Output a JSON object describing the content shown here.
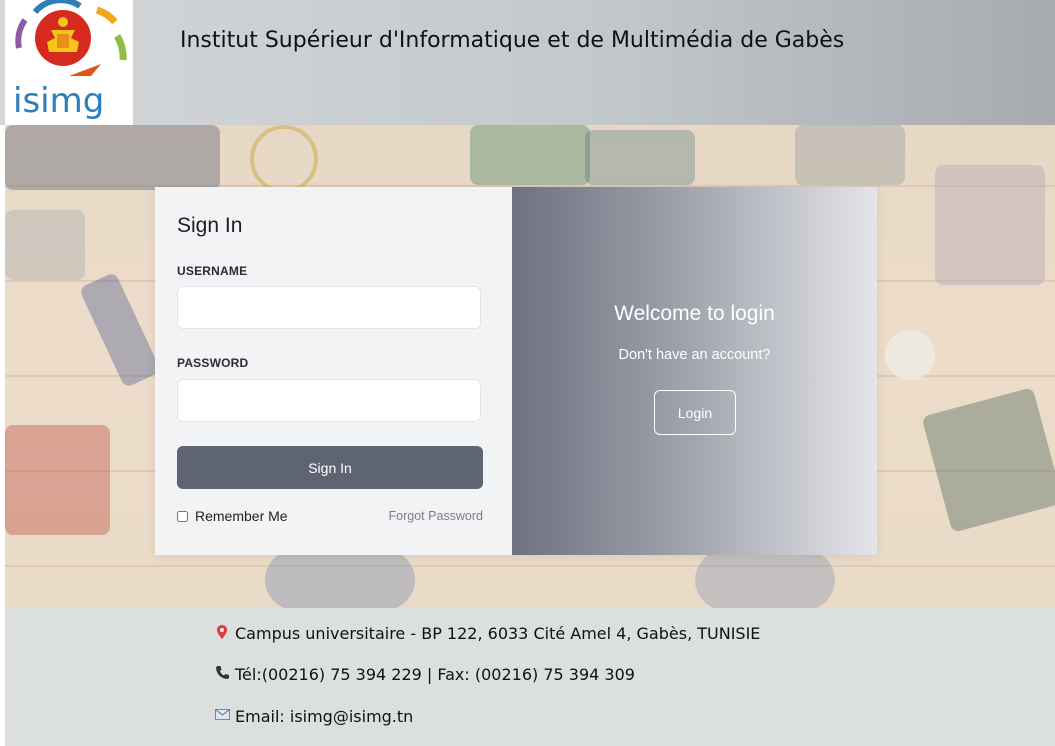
{
  "header": {
    "logo_text": "isimg",
    "title": "Institut Supérieur d'Informatique  et de Multimédia de Gabès"
  },
  "signin": {
    "title": "Sign In",
    "username_label": "USERNAME",
    "username_value": "",
    "password_label": "PASSWORD",
    "password_value": "",
    "submit_label": "Sign In",
    "remember_label": "Remember Me",
    "forgot_label": "Forgot Password"
  },
  "welcome": {
    "title": "Welcome to login",
    "subtitle": "Don't have an account?",
    "login_label": "Login"
  },
  "footer": {
    "address": "Campus universitaire - BP 122, 6033 Cité Amel 4, Gabès, TUNISIE",
    "phone": "Tél:(00216) 75 394 229 | Fax: (00216) 75 394 309",
    "email": "Email: isimg@isimg.tn",
    "icons": [
      "location-pin-icon",
      "phone-icon",
      "email-icon"
    ]
  },
  "colors": {
    "signin_button": "#5f6472",
    "welcome_gradient_start": "#6e7280",
    "welcome_gradient_end": "#e4e5ea",
    "footer_bg": "#dbdfe0"
  }
}
